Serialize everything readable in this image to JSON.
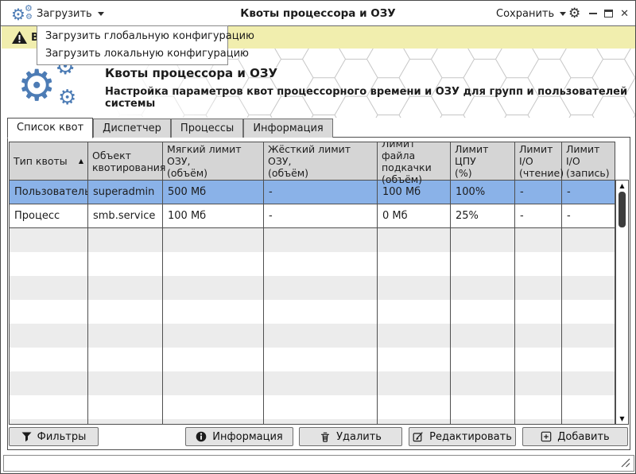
{
  "window": {
    "title": "Квоты процессора и ОЗУ"
  },
  "menubar": {
    "load_label": "Загрузить",
    "save_label": "Сохранить"
  },
  "load_menu": {
    "items": [
      {
        "key": "load-global-config",
        "label": "Загрузить глобальную конфигурацию"
      },
      {
        "key": "load-local-config",
        "label": "Загрузить локальную конфигурацию"
      }
    ]
  },
  "warning": {
    "text": "В"
  },
  "header": {
    "title": "Квоты процессора и ОЗУ",
    "subtitle": "Настройка параметров квот процессорного времени и ОЗУ для групп и пользователей системы"
  },
  "tabs": [
    {
      "key": "quota-list",
      "label": "Список квот",
      "active": true
    },
    {
      "key": "dispatcher",
      "label": "Диспетчер",
      "active": false
    },
    {
      "key": "processes",
      "label": "Процессы",
      "active": false
    },
    {
      "key": "information",
      "label": "Информация",
      "active": false
    }
  ],
  "table": {
    "columns": [
      "Тип квоты",
      "Объект\nквотирования",
      "Мягкий лимит ОЗУ,\n(объём)",
      "Жёсткий лимит ОЗУ,\n(объём)",
      "Лимит файла\nподкачки\n(объём)",
      "Лимит ЦПУ\n(%)",
      "Лимит\nI/O\n(чтение)",
      "Лимит\nI/O\n(запись)"
    ],
    "sorted_column_index": 0,
    "rows": [
      {
        "selected": true,
        "cells": [
          "Пользователь",
          "superadmin",
          "500 Мб",
          "-",
          "100 Мб",
          "100%",
          "-",
          "-"
        ]
      },
      {
        "selected": false,
        "cells": [
          "Процесс",
          "smb.service",
          "100 Мб",
          "-",
          "0 Мб",
          "25%",
          "-",
          "-"
        ]
      }
    ]
  },
  "buttons": {
    "filters": "Фильтры",
    "info": "Информация",
    "delete": "Удалить",
    "edit": "Редактировать",
    "add": "Добавить"
  },
  "icons": {
    "gear": "⚙",
    "sort_asc": "▲",
    "scroll_up": "▲",
    "scroll_down": "▼",
    "close": "✕"
  },
  "colors": {
    "accent": "#4d7cb5",
    "selected_row": "#8ab2e8",
    "warning_bg": "#f1eeae"
  }
}
